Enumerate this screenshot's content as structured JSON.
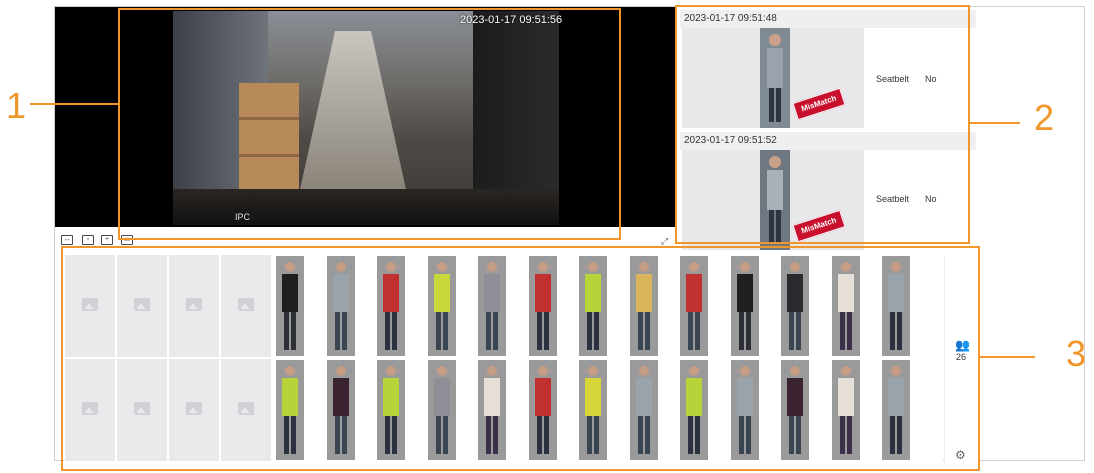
{
  "video": {
    "timestamp": "2023-01-17 09:51:56",
    "channel": "IPC"
  },
  "records": [
    {
      "time": "2023-01-17 09:51:48",
      "badge": "MisMatch",
      "attr_label": "Seatbelt",
      "attr_value": "No"
    },
    {
      "time": "2023-01-17 09:51:52",
      "badge": "MisMatch",
      "attr_label": "Seatbelt",
      "attr_value": "No"
    }
  ],
  "gallery": {
    "count": "26"
  },
  "callouts": [
    "1",
    "2",
    "3"
  ],
  "colors": {
    "highlight": "#f0962b",
    "badge": "#c8102e"
  },
  "icons": [
    "split-layout-icon",
    "fit-icon",
    "original-size-icon",
    "window-layout-icon",
    "fullscreen-icon",
    "people-icon",
    "settings-gear-icon",
    "image-placeholder-icon"
  ]
}
